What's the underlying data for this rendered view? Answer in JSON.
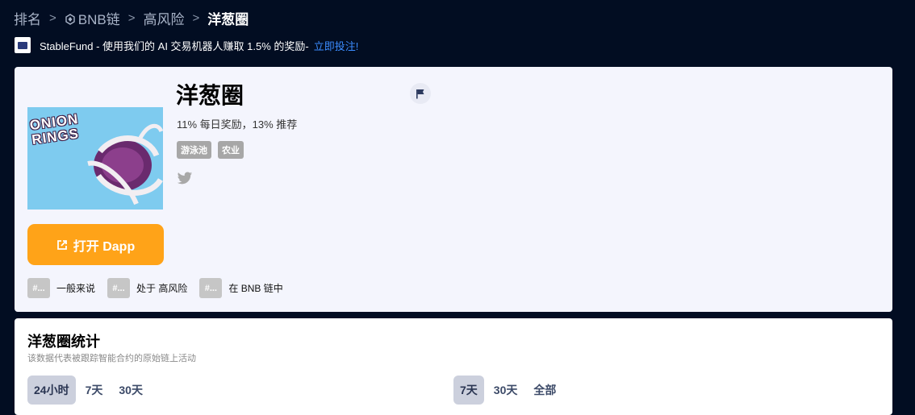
{
  "breadcrumb": {
    "items": [
      "排名",
      "BNB链",
      "高风险",
      "洋葱圈"
    ],
    "separator": ">"
  },
  "promo": {
    "text": "StableFund - 使用我们的 AI 交易机器人赚取 1.5% 的奖励-",
    "link": "立即投注!"
  },
  "dapp": {
    "name": "洋葱圈",
    "subtitle": "11% 每日奖励，13% 推荐",
    "image_text": "ONION\nRINGS",
    "tags": [
      "游泳池",
      "农业"
    ],
    "open_button": "打开 Dapp",
    "hashtags": [
      {
        "box": "#...",
        "label": "一般来说"
      },
      {
        "box": "#...",
        "label": "处于 高风险"
      },
      {
        "box": "#...",
        "label": "在 BNB 链中"
      }
    ]
  },
  "stats": {
    "title": "洋葱圈统计",
    "subtitle": "该数据代表被跟踪智能合约的原始链上活动",
    "left_tabs": [
      "24小时",
      "7天",
      "30天"
    ],
    "right_tabs": [
      "7天",
      "30天",
      "全部"
    ]
  },
  "colors": {
    "background": "#020d22",
    "card": "#f4f5fd",
    "accent_orange": "#ffa318",
    "link_blue": "#3b8cff"
  },
  "icons": [
    "chevron-right-icon",
    "bnb-chain-icon",
    "external-link-icon",
    "twitter-icon",
    "flag-icon"
  ]
}
